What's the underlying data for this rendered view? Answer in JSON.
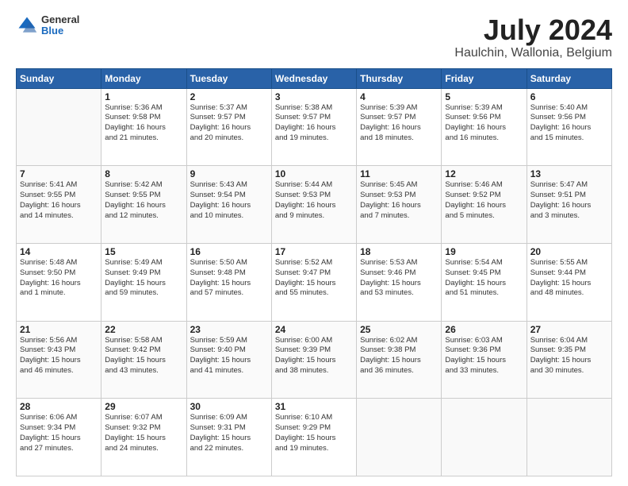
{
  "header": {
    "logo": {
      "general": "General",
      "blue": "Blue"
    },
    "title": "July 2024",
    "subtitle": "Haulchin, Wallonia, Belgium"
  },
  "columns": [
    "Sunday",
    "Monday",
    "Tuesday",
    "Wednesday",
    "Thursday",
    "Friday",
    "Saturday"
  ],
  "weeks": [
    [
      {
        "day": "",
        "info": ""
      },
      {
        "day": "1",
        "info": "Sunrise: 5:36 AM\nSunset: 9:58 PM\nDaylight: 16 hours\nand 21 minutes."
      },
      {
        "day": "2",
        "info": "Sunrise: 5:37 AM\nSunset: 9:57 PM\nDaylight: 16 hours\nand 20 minutes."
      },
      {
        "day": "3",
        "info": "Sunrise: 5:38 AM\nSunset: 9:57 PM\nDaylight: 16 hours\nand 19 minutes."
      },
      {
        "day": "4",
        "info": "Sunrise: 5:39 AM\nSunset: 9:57 PM\nDaylight: 16 hours\nand 18 minutes."
      },
      {
        "day": "5",
        "info": "Sunrise: 5:39 AM\nSunset: 9:56 PM\nDaylight: 16 hours\nand 16 minutes."
      },
      {
        "day": "6",
        "info": "Sunrise: 5:40 AM\nSunset: 9:56 PM\nDaylight: 16 hours\nand 15 minutes."
      }
    ],
    [
      {
        "day": "7",
        "info": "Sunrise: 5:41 AM\nSunset: 9:55 PM\nDaylight: 16 hours\nand 14 minutes."
      },
      {
        "day": "8",
        "info": "Sunrise: 5:42 AM\nSunset: 9:55 PM\nDaylight: 16 hours\nand 12 minutes."
      },
      {
        "day": "9",
        "info": "Sunrise: 5:43 AM\nSunset: 9:54 PM\nDaylight: 16 hours\nand 10 minutes."
      },
      {
        "day": "10",
        "info": "Sunrise: 5:44 AM\nSunset: 9:53 PM\nDaylight: 16 hours\nand 9 minutes."
      },
      {
        "day": "11",
        "info": "Sunrise: 5:45 AM\nSunset: 9:53 PM\nDaylight: 16 hours\nand 7 minutes."
      },
      {
        "day": "12",
        "info": "Sunrise: 5:46 AM\nSunset: 9:52 PM\nDaylight: 16 hours\nand 5 minutes."
      },
      {
        "day": "13",
        "info": "Sunrise: 5:47 AM\nSunset: 9:51 PM\nDaylight: 16 hours\nand 3 minutes."
      }
    ],
    [
      {
        "day": "14",
        "info": "Sunrise: 5:48 AM\nSunset: 9:50 PM\nDaylight: 16 hours\nand 1 minute."
      },
      {
        "day": "15",
        "info": "Sunrise: 5:49 AM\nSunset: 9:49 PM\nDaylight: 15 hours\nand 59 minutes."
      },
      {
        "day": "16",
        "info": "Sunrise: 5:50 AM\nSunset: 9:48 PM\nDaylight: 15 hours\nand 57 minutes."
      },
      {
        "day": "17",
        "info": "Sunrise: 5:52 AM\nSunset: 9:47 PM\nDaylight: 15 hours\nand 55 minutes."
      },
      {
        "day": "18",
        "info": "Sunrise: 5:53 AM\nSunset: 9:46 PM\nDaylight: 15 hours\nand 53 minutes."
      },
      {
        "day": "19",
        "info": "Sunrise: 5:54 AM\nSunset: 9:45 PM\nDaylight: 15 hours\nand 51 minutes."
      },
      {
        "day": "20",
        "info": "Sunrise: 5:55 AM\nSunset: 9:44 PM\nDaylight: 15 hours\nand 48 minutes."
      }
    ],
    [
      {
        "day": "21",
        "info": "Sunrise: 5:56 AM\nSunset: 9:43 PM\nDaylight: 15 hours\nand 46 minutes."
      },
      {
        "day": "22",
        "info": "Sunrise: 5:58 AM\nSunset: 9:42 PM\nDaylight: 15 hours\nand 43 minutes."
      },
      {
        "day": "23",
        "info": "Sunrise: 5:59 AM\nSunset: 9:40 PM\nDaylight: 15 hours\nand 41 minutes."
      },
      {
        "day": "24",
        "info": "Sunrise: 6:00 AM\nSunset: 9:39 PM\nDaylight: 15 hours\nand 38 minutes."
      },
      {
        "day": "25",
        "info": "Sunrise: 6:02 AM\nSunset: 9:38 PM\nDaylight: 15 hours\nand 36 minutes."
      },
      {
        "day": "26",
        "info": "Sunrise: 6:03 AM\nSunset: 9:36 PM\nDaylight: 15 hours\nand 33 minutes."
      },
      {
        "day": "27",
        "info": "Sunrise: 6:04 AM\nSunset: 9:35 PM\nDaylight: 15 hours\nand 30 minutes."
      }
    ],
    [
      {
        "day": "28",
        "info": "Sunrise: 6:06 AM\nSunset: 9:34 PM\nDaylight: 15 hours\nand 27 minutes."
      },
      {
        "day": "29",
        "info": "Sunrise: 6:07 AM\nSunset: 9:32 PM\nDaylight: 15 hours\nand 24 minutes."
      },
      {
        "day": "30",
        "info": "Sunrise: 6:09 AM\nSunset: 9:31 PM\nDaylight: 15 hours\nand 22 minutes."
      },
      {
        "day": "31",
        "info": "Sunrise: 6:10 AM\nSunset: 9:29 PM\nDaylight: 15 hours\nand 19 minutes."
      },
      {
        "day": "",
        "info": ""
      },
      {
        "day": "",
        "info": ""
      },
      {
        "day": "",
        "info": ""
      }
    ]
  ]
}
